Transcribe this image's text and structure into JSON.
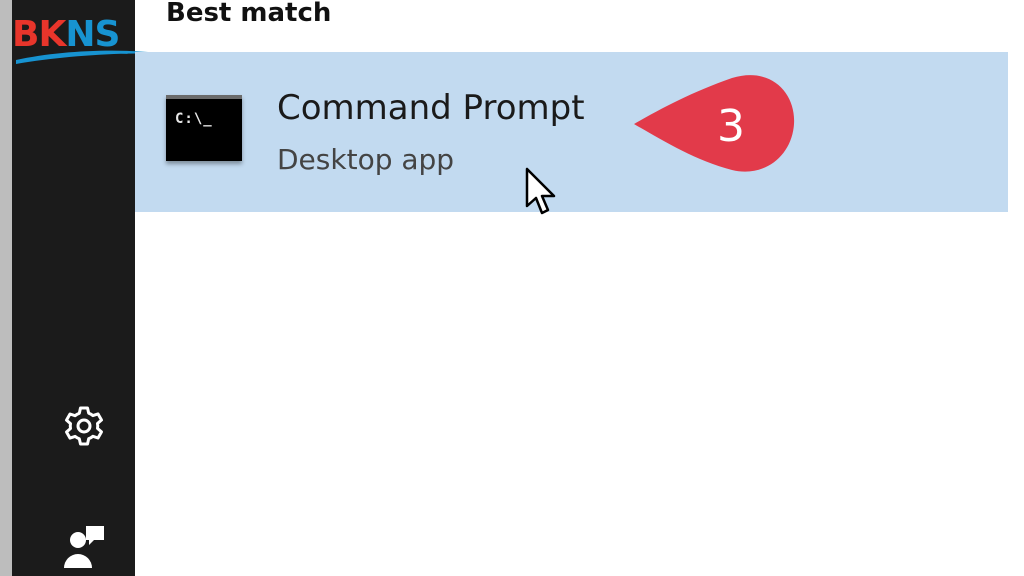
{
  "watermark": {
    "brand": "BKNS",
    "part_red": "BK",
    "part_blue": "NS",
    "colors": {
      "red": "#e8352b",
      "blue": "#1793d1"
    }
  },
  "search_results": {
    "section_heading": "Best match",
    "best_match": {
      "title": "Command Prompt",
      "subtitle": "Desktop app",
      "icon": "command-prompt-icon",
      "icon_text": "C:\\_",
      "highlight_color": "#c2daf0"
    }
  },
  "annotation": {
    "step_number": "3",
    "color": "#e23a4a"
  },
  "sidebar": {
    "background": "#1b1b1b",
    "icons": [
      "settings-gear-icon",
      "feedback-person-icon"
    ]
  }
}
